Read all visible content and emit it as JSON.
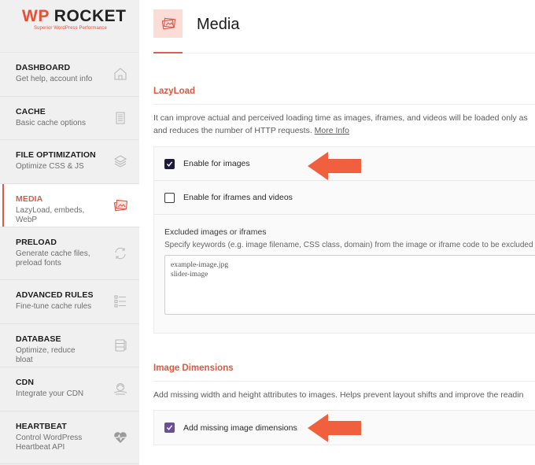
{
  "brand": {
    "logo_wp": "WP",
    "logo_rocket": "ROCKET",
    "tagline": "Superior WordPress Performance",
    "accent_color": "#e84f34"
  },
  "sidebar": {
    "items": [
      {
        "title": "DASHBOARD",
        "subtitle": "Get help, account info",
        "icon": "home-icon",
        "active": false
      },
      {
        "title": "CACHE",
        "subtitle": "Basic cache options",
        "icon": "document-icon",
        "active": false
      },
      {
        "title": "FILE OPTIMIZATION",
        "subtitle": "Optimize CSS & JS",
        "icon": "layers-icon",
        "active": false
      },
      {
        "title": "MEDIA",
        "subtitle": "LazyLoad, embeds, WebP",
        "icon": "images-icon",
        "active": true
      },
      {
        "title": "PRELOAD",
        "subtitle": "Generate cache files, preload fonts",
        "icon": "refresh-icon",
        "active": false
      },
      {
        "title": "ADVANCED RULES",
        "subtitle": "Fine-tune cache rules",
        "icon": "list-icon",
        "active": false
      },
      {
        "title": "DATABASE",
        "subtitle": "Optimize, reduce bloat",
        "icon": "database-icon",
        "active": false
      },
      {
        "title": "CDN",
        "subtitle": "Integrate your CDN",
        "icon": "cdn-icon",
        "active": false
      },
      {
        "title": "HEARTBEAT",
        "subtitle": "Control WordPress Heartbeat API",
        "icon": "heartbeat-icon",
        "active": false
      }
    ]
  },
  "header": {
    "title": "Media",
    "icon": "images-icon"
  },
  "lazyload": {
    "title": "LazyLoad",
    "description_line1": "It can improve actual and perceived loading time as images, iframes, and videos will be loaded only as",
    "description_line2": "and reduces the number of HTTP requests. ",
    "more_info_link": "More Info",
    "options": [
      {
        "label": "Enable for images",
        "checked": true
      },
      {
        "label": "Enable for iframes and videos",
        "checked": false
      }
    ],
    "excluded": {
      "title": "Excluded images or iframes",
      "description": "Specify keywords (e.g. image filename, CSS class, domain) from the image or iframe code to be excluded (o",
      "value": "example-image.jpg\nslider-image"
    }
  },
  "image_dimensions": {
    "title": "Image Dimensions",
    "description": "Add missing width and height attributes to images. Helps prevent layout shifts and improve the readin",
    "options": [
      {
        "label": "Add missing image dimensions",
        "checked": true
      }
    ]
  },
  "annotations": {
    "arrow_color": "#f0603f"
  }
}
